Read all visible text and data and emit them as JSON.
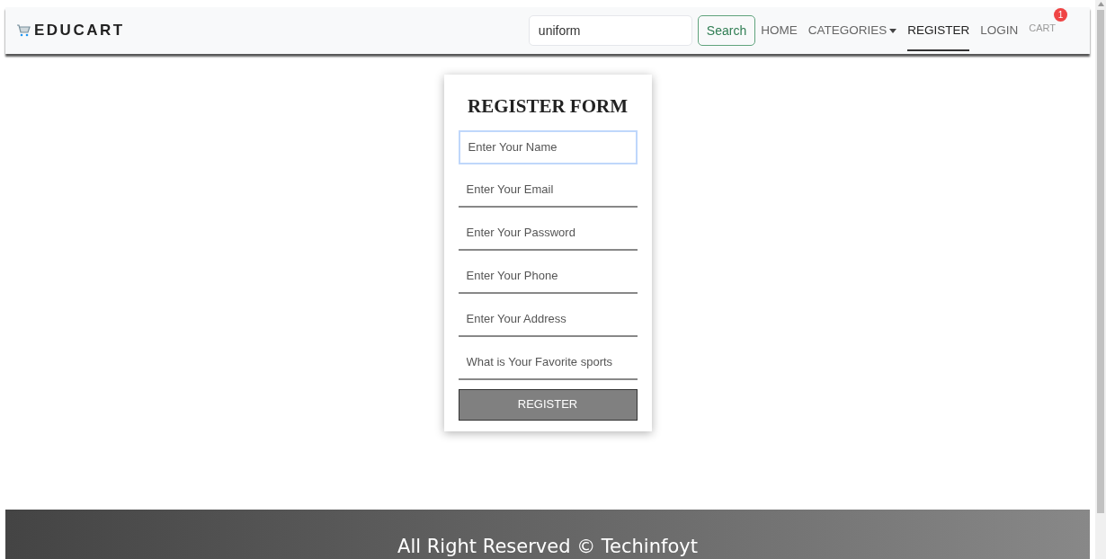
{
  "brand": "EDUCART",
  "search": {
    "value": "uniform",
    "button": "Search"
  },
  "nav": [
    {
      "label": "HOME",
      "selected": false,
      "kind": "link"
    },
    {
      "label": "CATEGORIES",
      "selected": false,
      "kind": "dropdown"
    },
    {
      "label": "REGISTER",
      "selected": true,
      "kind": "link"
    },
    {
      "label": "LOGIN",
      "selected": false,
      "kind": "link"
    },
    {
      "label": "CART",
      "selected": false,
      "kind": "cart",
      "badge": "1"
    }
  ],
  "form": {
    "title": "REGISTER FORM",
    "fields": [
      {
        "placeholder": "Enter Your Name",
        "focused": true
      },
      {
        "placeholder": "Enter Your Email",
        "focused": false
      },
      {
        "placeholder": "Enter Your Password",
        "focused": false
      },
      {
        "placeholder": "Enter Your Phone",
        "focused": false
      },
      {
        "placeholder": "Enter Your Address",
        "focused": false
      },
      {
        "placeholder": "What is Your Favorite sports",
        "focused": false
      }
    ],
    "button": "REGISTER"
  },
  "footer": "All Right Reserved © Techinfoyt"
}
